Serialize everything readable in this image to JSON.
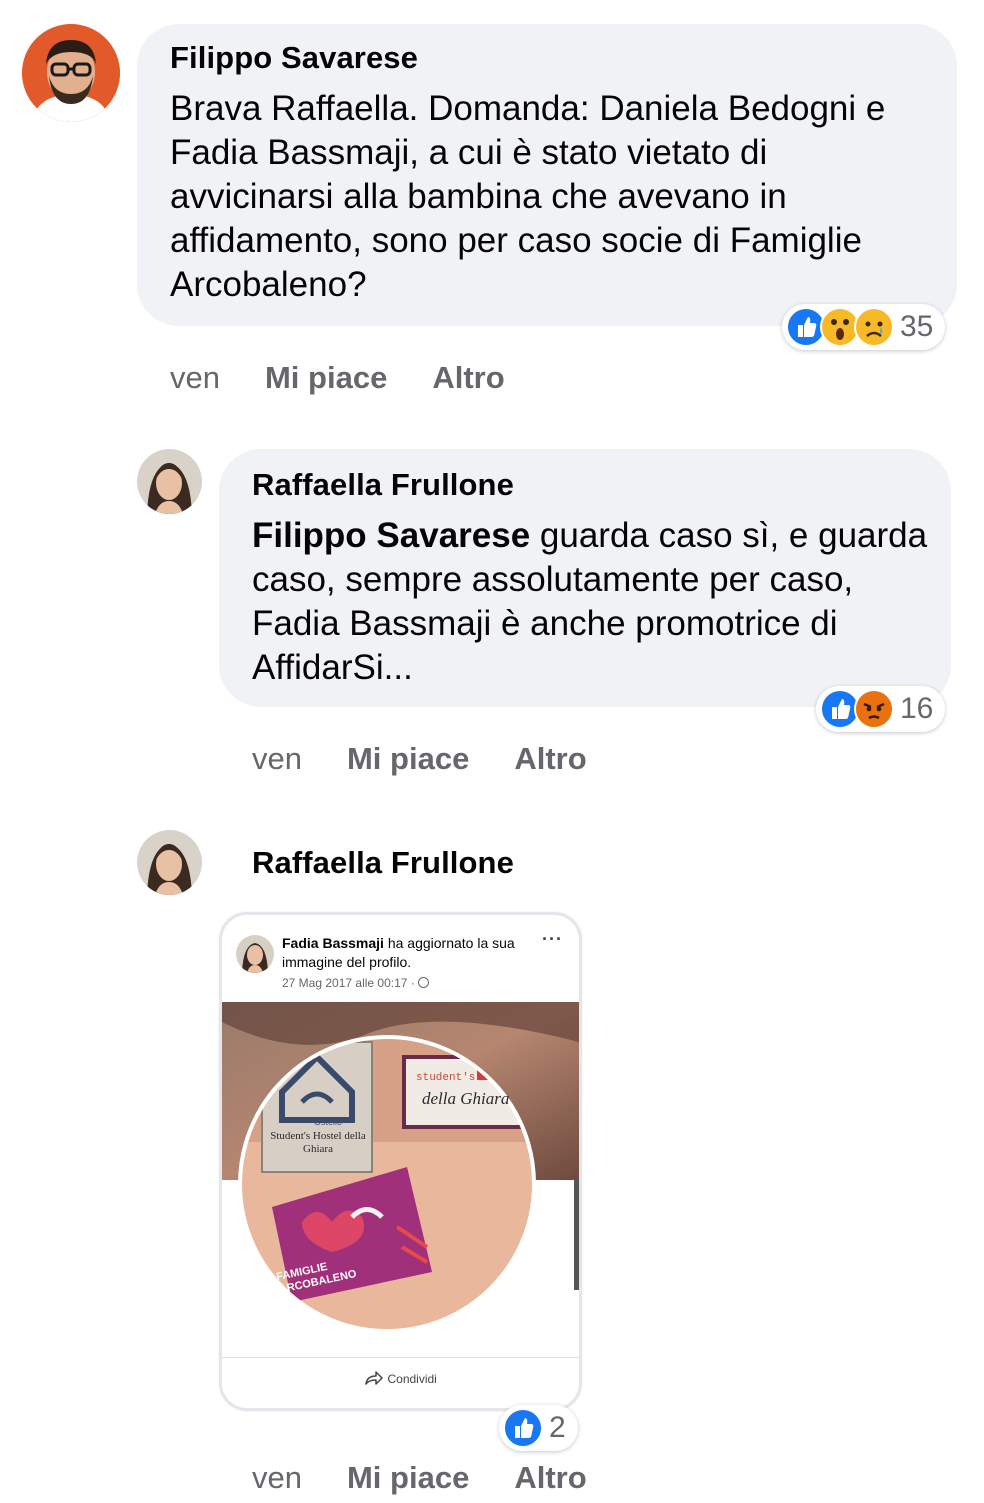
{
  "comments": [
    {
      "author": "Filippo Savarese",
      "text": "Brava Raffaella. Domanda: Daniela Bedogni e Fadia Bassmaji, a cui è stato vietato di avvicinarsi alla bambina che avevano in affidamento, sono per caso socie di Famiglie Arcobaleno?",
      "reaction_icons": [
        "like-icon",
        "wow-icon",
        "sad-icon"
      ],
      "reaction_count": "35",
      "time": "ven",
      "like_label": "Mi piace",
      "more_label": "Altro"
    },
    {
      "author": "Raffaella Frullone",
      "mention": "Filippo Savarese",
      "text": " guarda caso sì, e guarda caso, sempre assolutamente per caso, Fadia Bassmaji è anche promotrice di AffidarSi...",
      "reaction_icons": [
        "like-icon",
        "angry-icon"
      ],
      "reaction_count": "16",
      "time": "ven",
      "like_label": "Mi piace",
      "more_label": "Altro"
    },
    {
      "author": "Raffaella Frullone",
      "reaction_icons": [
        "like-icon"
      ],
      "reaction_count": "2",
      "time": "ven",
      "like_label": "Mi piace",
      "more_label": "Altro",
      "shared_post": {
        "author": "Fadia Bassmaji",
        "action": " ha aggiornato la sua immagine del profilo.",
        "date": "27 Mag 2017 alle 00:17 · ",
        "globe_icon": "globe-icon",
        "more_icon": "more-dots-icon",
        "share_label": "Condividi",
        "image_texts": {
          "hostel_sign": "Student's Hostel della Ghiara",
          "ostello": "Ostello",
          "plaque_line1": "student's",
          "plaque_line2": "della Ghiara",
          "flag_text": "FAMIGLIE ARCOBALENO"
        }
      }
    }
  ],
  "colors": {
    "bubble": "#f0f2f5",
    "meta_text": "#65676b",
    "like_blue": "#1877f2",
    "wow_yellow": "#f7b928",
    "angry_orange": "#e9710f"
  }
}
